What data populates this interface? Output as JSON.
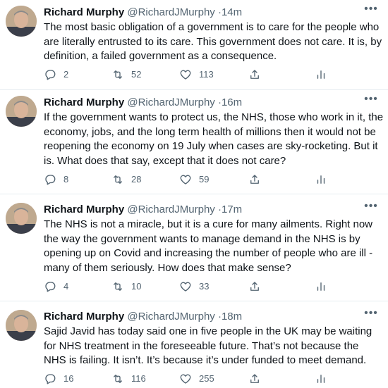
{
  "tweets": [
    {
      "name": "Richard Murphy",
      "handle": "@RichardJMurphy",
      "separator": "·",
      "time": "14m",
      "text": "The most basic obligation of a government is to care for the people who are literally entrusted to its care. This government does not care. It is, by definition, a failed government as a consequence.",
      "replies": "2",
      "retweets": "52",
      "likes": "113"
    },
    {
      "name": "Richard Murphy",
      "handle": "@RichardJMurphy",
      "separator": "·",
      "time": "16m",
      "text": "If the government wants to protect us, the NHS, those who work in it, the economy, jobs, and the long term health of millions then it would not be reopening the economy on 19 July when cases are sky-rocketing. But it is. What does that say, except that it does not care?",
      "replies": "8",
      "retweets": "28",
      "likes": "59"
    },
    {
      "name": "Richard Murphy",
      "handle": "@RichardJMurphy",
      "separator": "·",
      "time": "17m",
      "text": "The NHS is not a miracle, but it is a cure for many ailments. Right now the way the government wants to manage demand in the NHS is by opening up on Covid and increasing the number of people who are ill - many of them seriously. How does that make sense?",
      "replies": "4",
      "retweets": "10",
      "likes": "33"
    },
    {
      "name": "Richard Murphy",
      "handle": "@RichardJMurphy",
      "separator": "·",
      "time": "18m",
      "text": "Sajid Javid has today said one in five people in the UK may be waiting for NHS treatment in the foreseeable future. That’s not because the NHS is failing. It isn’t. It’s because it’s under funded to meet demand.",
      "replies": "16",
      "retweets": "116",
      "likes": "255"
    }
  ],
  "icons": {
    "reply": "reply-icon",
    "retweet": "retweet-icon",
    "like": "heart-icon",
    "share": "share-icon",
    "analytics": "analytics-icon",
    "more": "more-icon"
  },
  "colors": {
    "text": "#0f1419",
    "muted": "#536471",
    "divider": "#e6ecf0"
  }
}
